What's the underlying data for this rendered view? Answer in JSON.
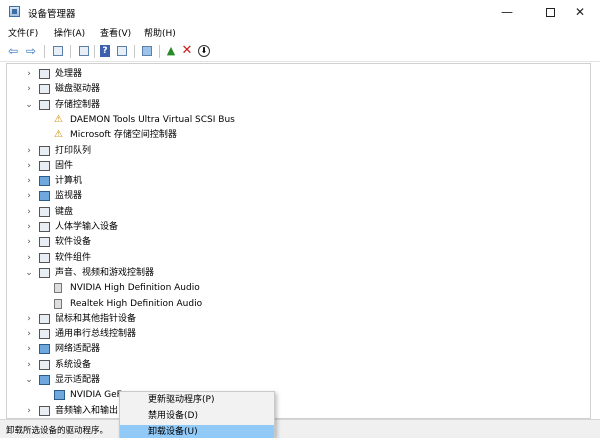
{
  "window": {
    "title": "设备管理器",
    "min_glyph": "—",
    "close_glyph": "✕"
  },
  "menu": [
    "文件(F)",
    "操作(A)",
    "查看(V)",
    "帮助(H)"
  ],
  "toolbar": {
    "back_glyph": "⇦",
    "forward_glyph": "⇨",
    "help_glyph": "?",
    "remove_glyph": "✕",
    "download_glyph": "⬇"
  },
  "tree": {
    "expanded_glyph": "⌄",
    "collapsed_glyph": "›",
    "items": [
      {
        "label": "处理器",
        "state": "collapsed",
        "icon": "cpu-icon"
      },
      {
        "label": "磁盘驱动器",
        "state": "collapsed",
        "icon": "disk-icon"
      },
      {
        "label": "存储控制器",
        "state": "expanded",
        "icon": "storage-icon"
      },
      {
        "label": "DAEMON Tools Ultra Virtual SCSI Bus",
        "state": "child",
        "icon": "storage-warning-icon"
      },
      {
        "label": "Microsoft 存储空间控制器",
        "state": "child",
        "icon": "storage-warning-icon"
      },
      {
        "label": "打印队列",
        "state": "collapsed",
        "icon": "printer-icon"
      },
      {
        "label": "固件",
        "state": "collapsed",
        "icon": "firmware-icon"
      },
      {
        "label": "计算机",
        "state": "collapsed",
        "icon": "computer-icon"
      },
      {
        "label": "监视器",
        "state": "collapsed",
        "icon": "monitor-icon"
      },
      {
        "label": "键盘",
        "state": "collapsed",
        "icon": "keyboard-icon"
      },
      {
        "label": "人体学输入设备",
        "state": "collapsed",
        "icon": "hid-icon"
      },
      {
        "label": "软件设备",
        "state": "collapsed",
        "icon": "software-device-icon"
      },
      {
        "label": "软件组件",
        "state": "collapsed",
        "icon": "software-component-icon"
      },
      {
        "label": "声音、视频和游戏控制器",
        "state": "expanded",
        "icon": "sound-icon"
      },
      {
        "label": "NVIDIA High Definition Audio",
        "state": "child",
        "icon": "speaker-icon"
      },
      {
        "label": "Realtek High Definition Audio",
        "state": "child",
        "icon": "speaker-icon"
      },
      {
        "label": "鼠标和其他指针设备",
        "state": "collapsed",
        "icon": "mouse-icon"
      },
      {
        "label": "通用串行总线控制器",
        "state": "collapsed",
        "icon": "usb-icon"
      },
      {
        "label": "网络适配器",
        "state": "collapsed",
        "icon": "network-icon"
      },
      {
        "label": "系统设备",
        "state": "collapsed",
        "icon": "system-device-icon"
      },
      {
        "label": "显示适配器",
        "state": "expanded",
        "icon": "display-adapter-icon"
      },
      {
        "label": "NVIDIA GeF",
        "state": "child",
        "icon": "display-adapter-icon"
      },
      {
        "label": "音频输入和输出",
        "state": "collapsed",
        "icon": "audio-io-icon"
      }
    ]
  },
  "context_menu": [
    {
      "label": "更新驱动程序(P)",
      "highlighted": false
    },
    {
      "label": "禁用设备(D)",
      "highlighted": false
    },
    {
      "label": "卸载设备(U)",
      "highlighted": true
    }
  ],
  "status": "卸载所选设备的驱动程序。"
}
